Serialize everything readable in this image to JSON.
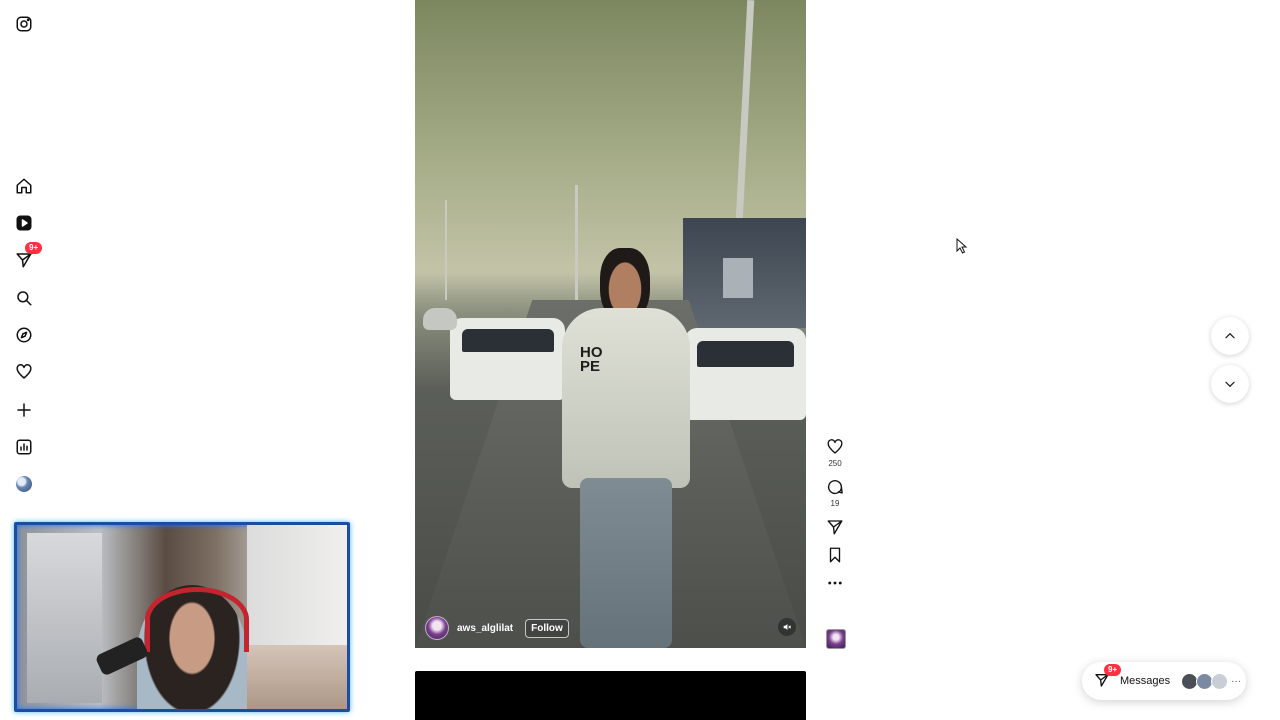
{
  "sidebar": {
    "notification_badge": "9+",
    "items": [
      {
        "name": "home"
      },
      {
        "name": "reels"
      },
      {
        "name": "messages"
      },
      {
        "name": "search"
      },
      {
        "name": "explore"
      },
      {
        "name": "notifications"
      },
      {
        "name": "create"
      },
      {
        "name": "dashboard"
      },
      {
        "name": "profile"
      }
    ]
  },
  "post": {
    "author": "aws_alglilat",
    "follow_label": "Follow",
    "shirt_text": "HO PE",
    "likes": "250",
    "comments": "19"
  },
  "messages": {
    "label": "Messages",
    "badge": "9+",
    "more": "···"
  },
  "colors": {
    "accent_badge": "#ff3040",
    "webcam_border": "#1b4da3"
  }
}
